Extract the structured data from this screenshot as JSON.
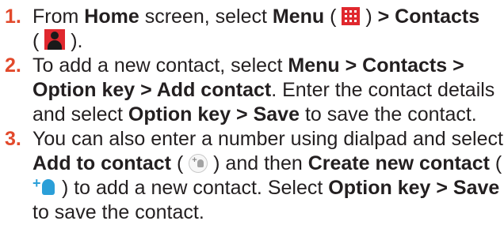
{
  "steps": [
    {
      "number": "1.",
      "t1": "From ",
      "b1": "Home",
      "t2": " screen, select ",
      "b2": "Menu",
      "t3": " ( ",
      "icon1": "menu-grid-icon",
      "t4": " ) ",
      "b3": "> Contacts",
      "t5": " ( ",
      "icon2": "contacts-app-icon",
      "t6": " )."
    },
    {
      "number": "2.",
      "t1": "To add a new contact, select ",
      "b1": "Menu > Contacts > Option key > Add contact",
      "t2": ". Enter the contact details and select ",
      "b2": "Option key > Save",
      "t3": " to save the contact."
    },
    {
      "number": "3.",
      "t1": "You can also enter a number using dialpad and select ",
      "b1": "Add to contact",
      "t2": " ( ",
      "icon1": "add-to-contact-icon",
      "t3": " ) and then ",
      "b2": "Create new contact",
      "t4": " ( ",
      "icon2": "new-contact-icon",
      "t5": " ) to add a new contact. Select ",
      "b3": "Option key > Save",
      "t6": " to save the contact."
    }
  ],
  "colors": {
    "number": "#e2492b",
    "text": "#231f20",
    "menu_icon_bg": "#e0282e",
    "new_contact_icon": "#2b9fd8"
  }
}
